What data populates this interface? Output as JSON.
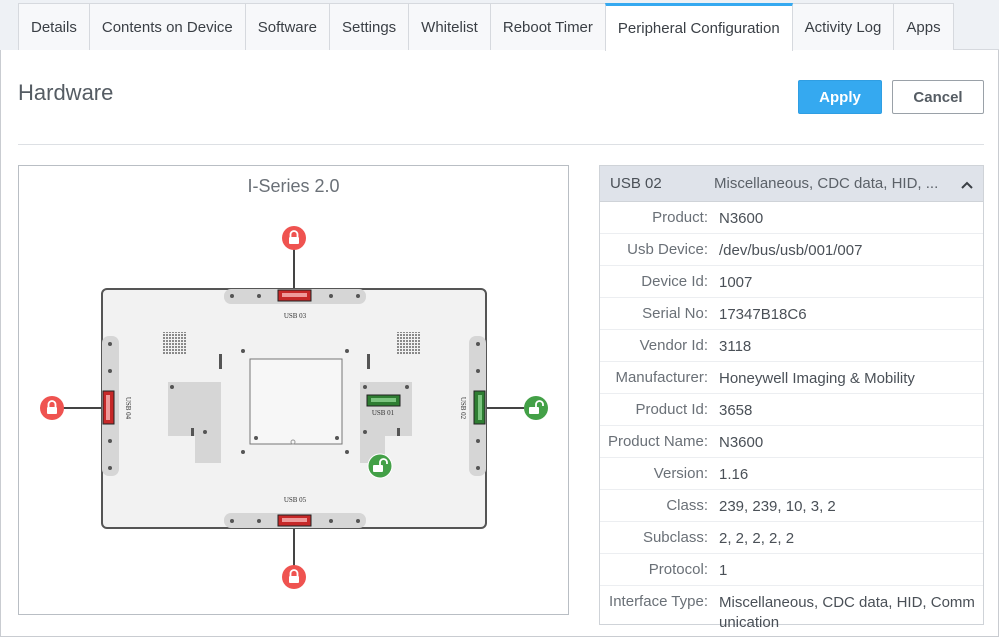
{
  "tabs": [
    {
      "label": "Details"
    },
    {
      "label": "Contents on Device"
    },
    {
      "label": "Software"
    },
    {
      "label": "Settings"
    },
    {
      "label": "Whitelist"
    },
    {
      "label": "Reboot Timer"
    },
    {
      "label": "Peripheral Configuration",
      "active": true
    },
    {
      "label": "Activity Log"
    },
    {
      "label": "Apps"
    }
  ],
  "section": {
    "title": "Hardware"
  },
  "actions": {
    "apply": "Apply",
    "cancel": "Cancel"
  },
  "device": {
    "title": "I-Series 2.0",
    "ports": {
      "usb01": {
        "label": "USB 01",
        "state": "unlocked"
      },
      "usb02": {
        "label": "USB 02",
        "state": "unlocked"
      },
      "usb03": {
        "label": "USB 03",
        "state": "locked"
      },
      "usb04": {
        "label": "USB 04",
        "state": "locked"
      },
      "usb05": {
        "label": "USB 05",
        "state": "locked"
      }
    }
  },
  "colors": {
    "locked": "#ef5350",
    "unlocked": "#43a047",
    "accent": "#35a9f0"
  },
  "usb_detail": {
    "port": "USB 02",
    "summary": "Miscellaneous, CDC data, HID, ...",
    "rows": [
      {
        "key": "Product:",
        "value": "N3600"
      },
      {
        "key": "Usb Device:",
        "value": "/dev/bus/usb/001/007"
      },
      {
        "key": "Device Id:",
        "value": "1007"
      },
      {
        "key": "Serial No:",
        "value": "17347B18C6"
      },
      {
        "key": "Vendor Id:",
        "value": "3118"
      },
      {
        "key": "Manufacturer:",
        "value": "Honeywell Imaging & Mobility"
      },
      {
        "key": "Product Id:",
        "value": "3658"
      },
      {
        "key": "Product Name:",
        "value": "N3600"
      },
      {
        "key": "Version:",
        "value": "1.16"
      },
      {
        "key": "Class:",
        "value": "239, 239, 10, 3, 2"
      },
      {
        "key": "Subclass:",
        "value": "2, 2, 2, 2, 2"
      },
      {
        "key": "Protocol:",
        "value": "1"
      },
      {
        "key": "Interface Type:",
        "value": "Miscellaneous, CDC data, HID, Communication"
      }
    ]
  }
}
